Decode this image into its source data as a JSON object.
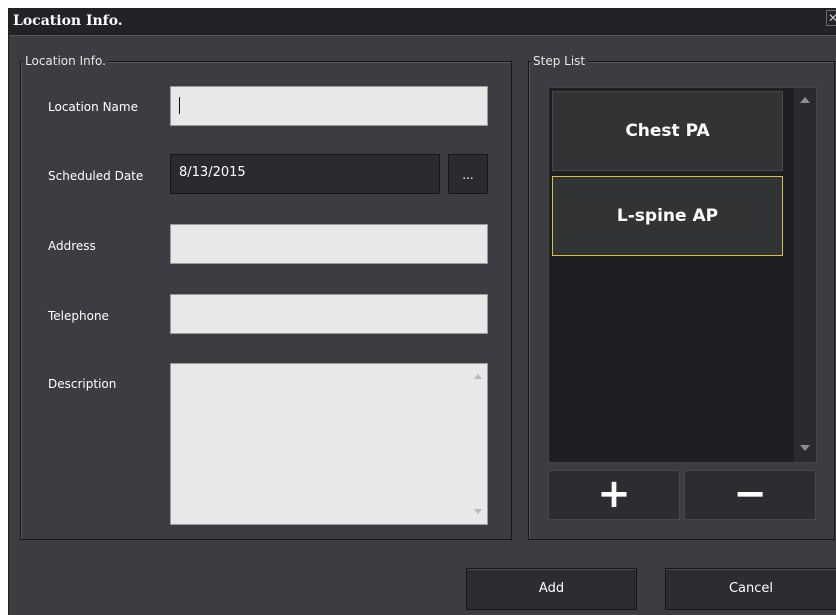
{
  "window": {
    "title": "Location Info.",
    "close_glyph": "✕"
  },
  "location_group": {
    "legend": "Location Info.",
    "fields": {
      "location_name": {
        "label": "Location Name",
        "value": ""
      },
      "scheduled_date": {
        "label": "Scheduled Date",
        "value": "8/13/2015",
        "browse_label": "..."
      },
      "address": {
        "label": "Address",
        "value": ""
      },
      "telephone": {
        "label": "Telephone",
        "value": ""
      },
      "description": {
        "label": "Description",
        "value": ""
      }
    }
  },
  "step_group": {
    "legend": "Step List",
    "items": [
      {
        "label": "Chest PA",
        "selected": false
      },
      {
        "label": "L-spine AP",
        "selected": true
      }
    ],
    "add_glyph": "+",
    "remove_glyph": "−"
  },
  "footer": {
    "add_label": "Add",
    "cancel_label": "Cancel"
  },
  "colors": {
    "background": "#3b3d42",
    "titlebar": "#222327",
    "selection_border": "#d4c23a",
    "input_fill": "#e8e8e8"
  },
  "icons": {
    "close": "close-icon",
    "scroll_up": "triangle-up-icon",
    "scroll_down": "triangle-down-icon",
    "add": "plus-icon",
    "remove": "minus-icon"
  }
}
